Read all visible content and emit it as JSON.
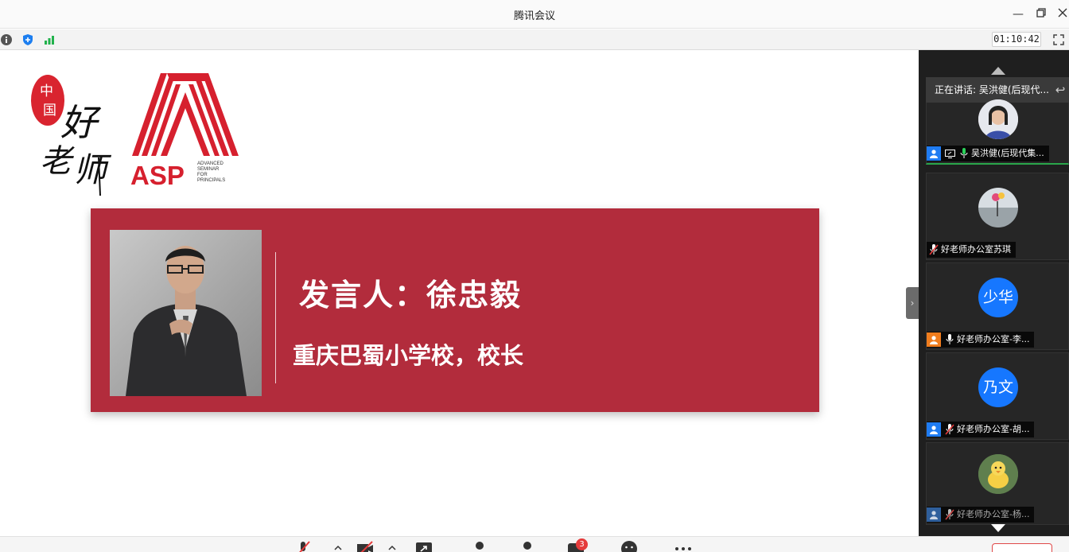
{
  "window": {
    "title": "腾讯会议"
  },
  "status": {
    "timer": "01:10:42"
  },
  "slide": {
    "banner": {
      "speaker_line": "发言人：徐忠毅",
      "affiliation": "重庆巴蜀小学校，校长",
      "color": "#b22c3c"
    }
  },
  "sidebar": {
    "speaking_label": "正在讲话: 吴洪健(后现代...",
    "participants": [
      {
        "name": "吴洪健(后现代集...",
        "avatar": "photo-woman",
        "mic": "on"
      },
      {
        "name": "好老师办公室苏琪",
        "avatar": "photo-landscape",
        "mic": "muted"
      },
      {
        "name": "好老师办公室-李...",
        "avatar_text": "少华",
        "avatar_color": "#1677ff",
        "mic": "on"
      },
      {
        "name": "好老师办公室-胡...",
        "avatar_text": "乃文",
        "avatar_color": "#1677ff",
        "mic": "muted"
      },
      {
        "name": "好老师办公室-杨...",
        "avatar": "photo-duck",
        "mic": "muted"
      }
    ]
  },
  "toolbar": {
    "chat_badge": "3"
  }
}
